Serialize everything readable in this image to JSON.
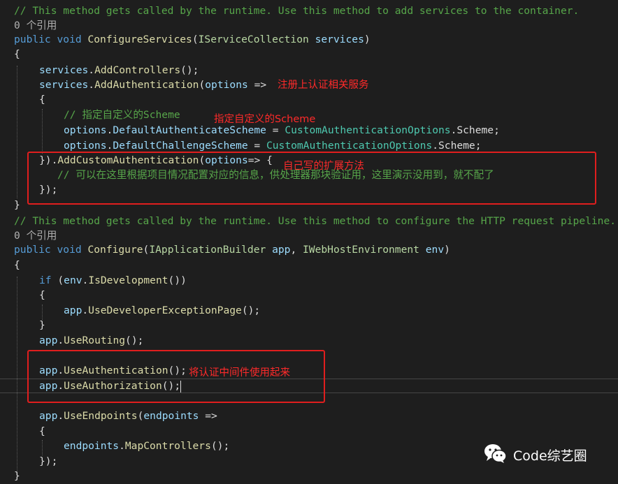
{
  "codelens_refs": "0 个引用",
  "code": {
    "l1": {
      "comment": "// This method gets called by the runtime. Use this method to add services to the container."
    },
    "l3": {
      "kw1": "public",
      "kw2": "void",
      "method": "ConfigureServices",
      "p1": "(",
      "iface": "IServiceCollection",
      "param": "services",
      "p2": ")"
    },
    "l4": {
      "brace": "{"
    },
    "l5": {
      "obj": "services",
      "dot": ".",
      "method": "AddControllers",
      "rest": "();"
    },
    "l6": {
      "obj": "services",
      "dot": ".",
      "method": "AddAuthentication",
      "p": "(",
      "param": "options",
      "arrow": " =>"
    },
    "l7": {
      "brace": "{"
    },
    "l8": {
      "comment": "// 指定自定义的Scheme"
    },
    "l9": {
      "obj": "options",
      "dot": ".",
      "prop": "DefaultAuthenticateScheme",
      "eq": " = ",
      "type": "CustomAuthenticationOptions",
      "dot2": ".",
      "rest": "Scheme;"
    },
    "l10": {
      "obj": "options",
      "dot": ".",
      "prop": "DefaultChallengeScheme",
      "eq": " = ",
      "type": "CustomAuthenticationOptions",
      "dot2": ".",
      "rest": "Scheme;"
    },
    "l11": {
      "pre": "}).",
      "method": "AddCustomAuthentication",
      "p": "(",
      "param": "options",
      "arrow": "=> {"
    },
    "l12": {
      "comment": "// 可以在这里根据项目情况配置对应的信息，供处理器那块验证用，这里演示没用到，就不配了"
    },
    "l13": {
      "text": "});"
    },
    "l14": {
      "brace": "}"
    },
    "l15": {
      "comment": "// This method gets called by the runtime. Use this method to configure the HTTP request pipeline."
    },
    "l17": {
      "kw1": "public",
      "kw2": "void",
      "method": "Configure",
      "p1": "(",
      "iface1": "IApplicationBuilder",
      "param1": "app",
      "comma": ", ",
      "iface2": "IWebHostEnvironment",
      "param2": "env",
      "p2": ")"
    },
    "l18": {
      "brace": "{"
    },
    "l19": {
      "kw": "if",
      "p1": " (",
      "obj": "env",
      "dot": ".",
      "method": "IsDevelopment",
      "rest": "())"
    },
    "l20": {
      "brace": "{"
    },
    "l21": {
      "obj": "app",
      "dot": ".",
      "method": "UseDeveloperExceptionPage",
      "rest": "();"
    },
    "l22": {
      "brace": "}"
    },
    "l23": {
      "obj": "app",
      "dot": ".",
      "method": "UseRouting",
      "rest": "();"
    },
    "l25": {
      "obj": "app",
      "dot": ".",
      "method": "UseAuthentication",
      "rest": "();"
    },
    "l26": {
      "obj": "app",
      "dot": ".",
      "method": "UseAuthorization",
      "rest": "();"
    },
    "l28": {
      "obj": "app",
      "dot": ".",
      "method": "UseEndpoints",
      "p": "(",
      "param": "endpoints",
      "arrow": " =>"
    },
    "l29": {
      "brace": "{"
    },
    "l30": {
      "obj": "endpoints",
      "dot": ".",
      "method": "MapControllers",
      "rest": "();"
    },
    "l31": {
      "text": "});"
    },
    "l32": {
      "brace": "}"
    }
  },
  "annotations": {
    "register_auth": "注册上认证相关服务",
    "custom_scheme": "指定自定义的Scheme",
    "extension_method": "自己写的扩展方法",
    "use_middleware": "将认证中间件使用起来"
  },
  "watermark": {
    "label": "Code综艺圈",
    "icon": "wechat-icon"
  },
  "colors": {
    "background": "#1e1e1e",
    "comment": "#57a64a",
    "keyword": "#569cd6",
    "type": "#4ec9b0",
    "annotation": "#ff2a2a"
  }
}
